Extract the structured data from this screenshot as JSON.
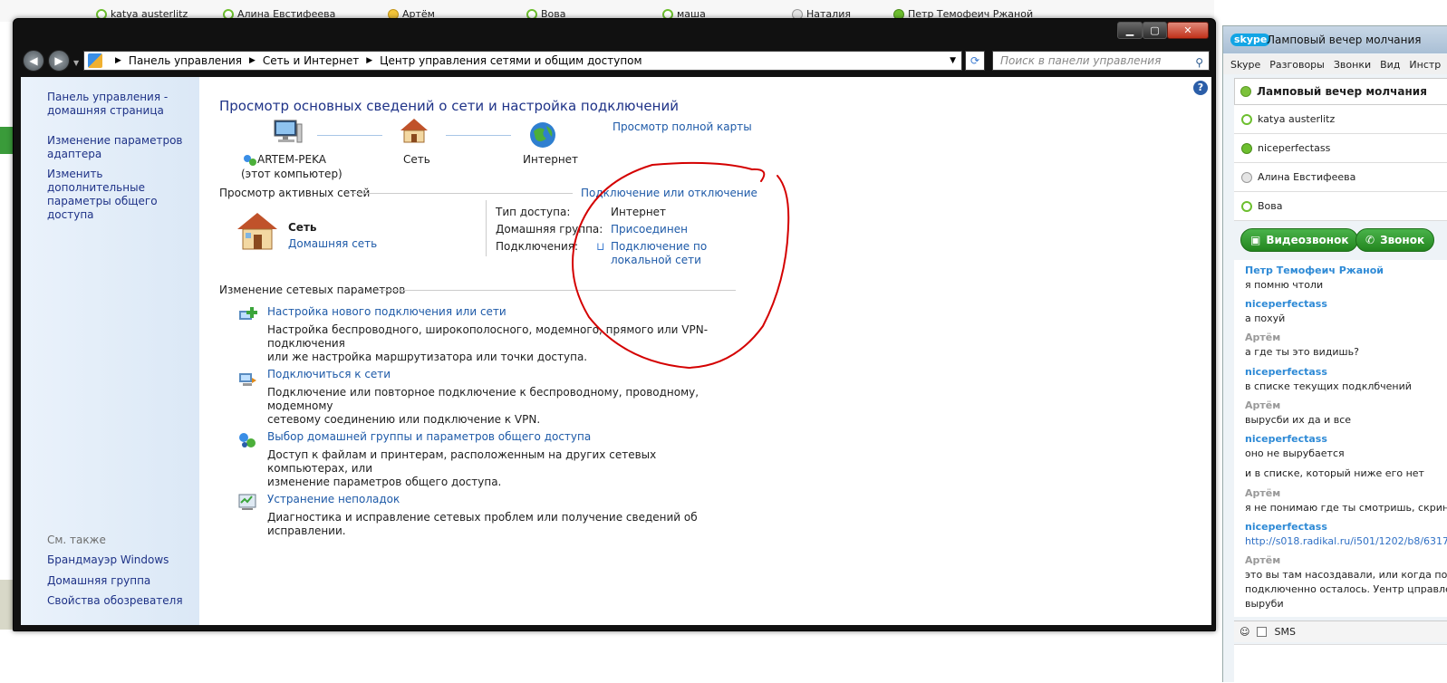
{
  "top_contacts": [
    {
      "name": "katya austerlitz",
      "status": "online-hollow"
    },
    {
      "name": "Алина Евстифеева",
      "status": "online-hollow"
    },
    {
      "name": "Артём",
      "status": "away"
    },
    {
      "name": "Вова",
      "status": "online-hollow"
    },
    {
      "name": "маша",
      "status": "online-hollow"
    },
    {
      "name": "Наталия",
      "status": "unknown"
    },
    {
      "name": "Петр Темофеич Ржаной",
      "status": "online"
    }
  ],
  "window": {
    "buttons": {
      "min": "▁",
      "max": "▢",
      "close": "✕"
    }
  },
  "address": {
    "crumbs": [
      "Панель управления",
      "Сеть и Интернет",
      "Центр управления сетями и общим доступом"
    ],
    "search_placeholder": "Поиск в панели управления"
  },
  "left_pane": {
    "links": [
      "Панель управления -\nдомашняя страница",
      "Изменение параметров\nадаптера",
      "Изменить дополнительные\nпараметры общего доступа"
    ],
    "see_also_label": "См. также",
    "see_also": [
      "Брандмауэр Windows",
      "Домашняя группа",
      "Свойства обозревателя"
    ]
  },
  "main": {
    "title": "Просмотр основных сведений о сети и настройка подключений",
    "full_map_link": "Просмотр полной карты",
    "map": {
      "computer_name": "ARTEM-PEKA",
      "computer_note": "(этот компьютер)",
      "network": "Сеть",
      "internet": "Интернет"
    },
    "active_networks_label": "Просмотр активных сетей",
    "connect_disconnect_link": "Подключение или отключение",
    "active_network": {
      "name": "Сеть",
      "type_link": "Домашняя сеть",
      "access_type_label": "Тип доступа:",
      "access_type_value": "Интернет",
      "homegroup_label": "Домашняя группа:",
      "homegroup_value": "Присоединен",
      "connections_label": "Подключения:",
      "connections_value": "Подключение по\nлокальной сети"
    },
    "change_settings_label": "Изменение сетевых параметров",
    "tasks": [
      {
        "title": "Настройка нового подключения или сети",
        "desc": "Настройка беспроводного, широкополосного, модемного, прямого или VPN-подключения\nили же настройка маршрутизатора или точки доступа."
      },
      {
        "title": "Подключиться к сети",
        "desc": "Подключение или повторное подключение к беспроводному, проводному, модемному\nсетевому соединению или подключение к VPN."
      },
      {
        "title": "Выбор домашней группы и параметров общего доступа",
        "desc": "Доступ к файлам и принтерам, расположенным на других сетевых компьютерах, или\nизменение параметров общего доступа."
      },
      {
        "title": "Устранение неполадок",
        "desc": "Диагностика и исправление сетевых проблем или получение сведений об исправлении."
      }
    ]
  },
  "skype": {
    "logo": "skype",
    "title": "Ламповый вечер молчания",
    "menu": [
      "Skype",
      "Разговоры",
      "Звонки",
      "Вид",
      "Инстр"
    ],
    "chat_name": "Ламповый вечер молчания",
    "members": [
      "katya austerlitz",
      "niceperfectass",
      "Алина Евстифеева",
      "Вова"
    ],
    "video_call": "Видеозвонок",
    "call": "Звонок",
    "messages": [
      {
        "author": "Петр Темофеич Ржаной",
        "style": "blue",
        "lines": [
          "я помню чтоли"
        ]
      },
      {
        "author": "niceperfectass",
        "style": "blue",
        "lines": [
          "а похуй"
        ]
      },
      {
        "author": "Артём",
        "style": "gray",
        "lines": [
          "а где ты это видишь?"
        ]
      },
      {
        "author": "niceperfectass",
        "style": "blue",
        "lines": [
          "в списке текущих подклбчений"
        ]
      },
      {
        "author": "Артём",
        "style": "gray",
        "lines": [
          "вырусби их да и все"
        ]
      },
      {
        "author": "niceperfectass",
        "style": "blue",
        "lines": [
          "оно не вырубается",
          "и в списке, который ниже его нет"
        ]
      },
      {
        "author": "Артём",
        "style": "gray",
        "lines": [
          "я не понимаю где ты смотришь, скрин"
        ]
      },
      {
        "author": "niceperfectass",
        "style": "blue",
        "link": "http://s018.radikal.ru/i501/1202/b8/6317"
      },
      {
        "author": "Артём",
        "style": "gray",
        "lines": [
          "это вы там насоздавали, или когда по",
          "подключенно осталось. Уентр цправле",
          "выруби"
        ]
      }
    ],
    "sms_label": "SMS"
  },
  "colors": {
    "link": "#1e5aa8",
    "title": "#1e3287",
    "annotation": "#d40000",
    "skype_green": "#2f9a2b"
  }
}
